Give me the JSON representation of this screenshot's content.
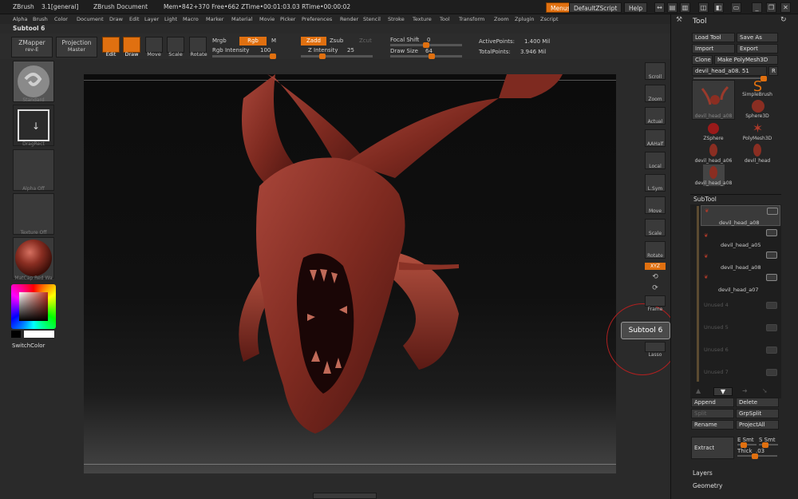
{
  "titlebar": {
    "app": "ZBrush",
    "version": "3.1[general]",
    "document": "ZBrush Document",
    "mem": "Mem•842+370 Free•662 ZTime•00:01:03.03 RTime•00:00:02",
    "menus_label": "Menus",
    "script_label": "DefaultZScript",
    "help_label": "Help"
  },
  "menubar": [
    "Alpha",
    "Brush",
    "Color",
    "Document",
    "Draw",
    "Edit",
    "Layer",
    "Light",
    "Macro",
    "Marker",
    "Material",
    "Movie",
    "Picker",
    "Preferences",
    "Render",
    "Stencil",
    "Stroke",
    "Texture",
    "Tool",
    "Transform",
    "Zoom",
    "Zplugin",
    "Zscript"
  ],
  "subtool_name": "Subtool 6",
  "toolbar": {
    "zmapper": "ZMapper",
    "zmapper_sub": "rev-E",
    "projection": "Projection",
    "projection_sub": "Master",
    "edit": "Edit",
    "draw": "Draw",
    "move": "Move",
    "scale": "Scale",
    "rotate": "Rotate",
    "mrgb": "Mrgb",
    "rgb": "Rgb",
    "m": "M",
    "rgb_intensity_label": "Rgb Intensity",
    "rgb_intensity": "100",
    "zadd": "Zadd",
    "zsub": "Zsub",
    "zcut": "Zcut",
    "z_intensity_label": "Z Intensity",
    "z_intensity": "25",
    "focal_shift_label": "Focal Shift",
    "focal_shift": "0",
    "draw_size_label": "Draw Size",
    "draw_size": "64",
    "active_points_label": "ActivePoints:",
    "active_points": "1.400 Mil",
    "total_points_label": "TotalPoints:",
    "total_points": "3.946 Mil"
  },
  "leftpanel": {
    "brush": "Standard",
    "stroke": "DragRect",
    "alpha": "Alpha Off",
    "texture": "Texture Off",
    "material": "MatCap Red Wa",
    "switch_color": "SwitchColor"
  },
  "rightstrip": [
    "Scroll",
    "Zoom",
    "Actual",
    "AAHalf",
    "Local",
    "L.Sym",
    "Move",
    "Scale",
    "Rotate",
    "Frame",
    "Lasso"
  ],
  "rightstrip_xyz": "XYZ",
  "tooltip": "Subtool 6",
  "toolpanel": {
    "title": "Tool",
    "load_tool": "Load Tool",
    "save_as": "Save As",
    "import": "Import",
    "export": "Export",
    "clone": "Clone",
    "make_polymesh": "Make PolyMesh3D",
    "current_tool": "devil_head_a08. 51",
    "r_label": "R",
    "tools": [
      {
        "name": "devil_head_a08",
        "icon": "devil-head-thumb"
      },
      {
        "name": "SimpleBrush",
        "icon": "simplebrush-thumb"
      },
      {
        "name": "Sphere3D",
        "icon": "sphere-thumb"
      },
      {
        "name": "ZSphere",
        "icon": "zsphere-thumb"
      },
      {
        "name": "PolyMesh3D",
        "icon": "polymesh-thumb"
      },
      {
        "name": "devil_head_a06",
        "icon": "devil-head-thumb"
      },
      {
        "name": "devil_head",
        "icon": "devil-head-thumb"
      },
      {
        "name": "devil_head_a08",
        "icon": "devil-head-thumb"
      }
    ],
    "subtool_header": "SubTool",
    "subtools": [
      "devil_head_a08",
      "devil_head_a05",
      "devil_head_a08",
      "devil_head_a07",
      "Unused 4",
      "Unused 5",
      "Unused 6",
      "Unused 7"
    ],
    "append": "Append",
    "delete": "Delete",
    "split": "Split",
    "grpsplit": "GrpSplit",
    "rename": "Rename",
    "projectall": "ProjectAll",
    "extract": "Extract",
    "e_smt": "E Smt",
    "s_smt": "S Smt",
    "thick_label": "Thick",
    "thick": ".03",
    "layers": "Layers",
    "geometry": "Geometry"
  },
  "colors": {
    "accent": "#e07010",
    "model": "#8a2e22",
    "bg": "#2a2a2a"
  }
}
